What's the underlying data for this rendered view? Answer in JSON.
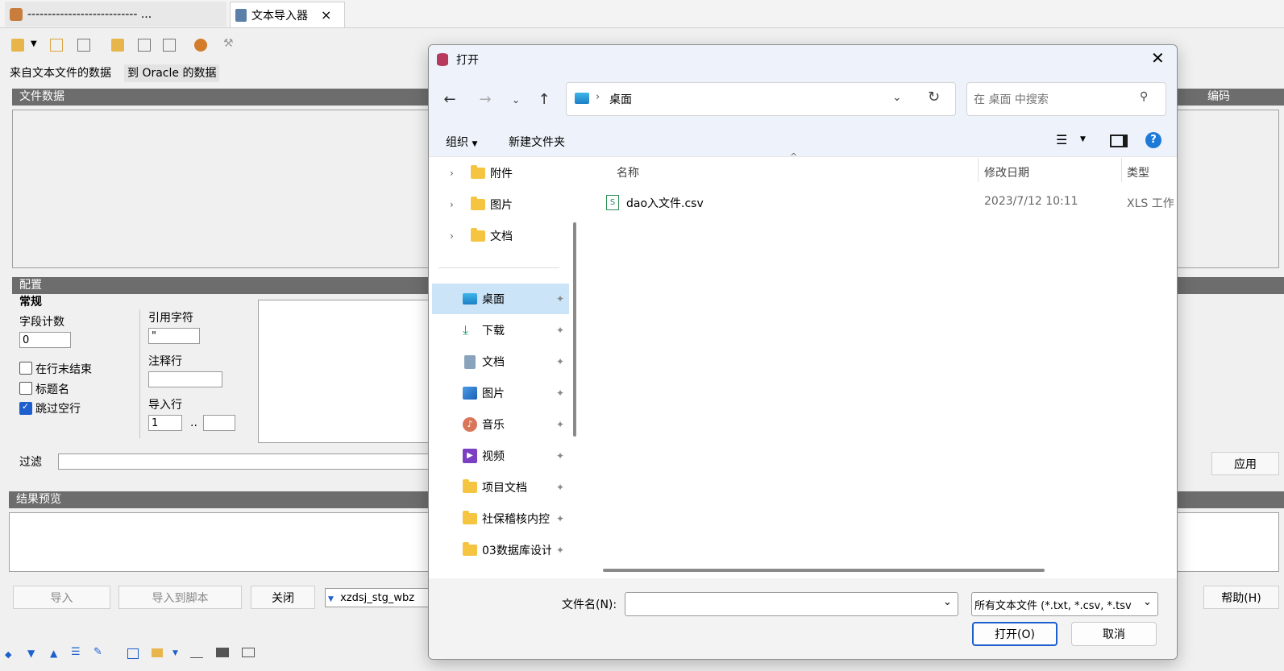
{
  "app": {
    "tabs": [
      {
        "label": "--------------------------- ..."
      },
      {
        "label": "文本导入器",
        "close": "×"
      }
    ],
    "subtabs": [
      "来自文本文件的数据",
      "到 Oracle 的数据"
    ],
    "sections": {
      "file_data": "文件数据",
      "config": "配置",
      "general": "常规",
      "result_preview": "结果预览",
      "encoding": "编码"
    },
    "config": {
      "field_count_label": "字段计数",
      "field_count_value": "0",
      "end_of_line": "在行末结束",
      "header": "标题名",
      "skip_empty": "跳过空行",
      "quote_char_label": "引用字符",
      "quote_char_value": "\"",
      "comment_label": "注释行",
      "import_rows_label": "导入行",
      "import_rows_from": "1",
      "import_rows_sep": ".."
    },
    "filter_label": "过滤",
    "apply_btn": "应用",
    "buttons": {
      "import": "导入",
      "import_script": "导入到脚本",
      "close": "关闭",
      "table": "xzdsj_stg_wbz",
      "help": "帮助(H)"
    }
  },
  "dialog": {
    "title": "打开",
    "address": "桌面",
    "search_placeholder": "在 桌面 中搜索",
    "organize": "组织",
    "new_folder": "新建文件夹",
    "tree_top": [
      {
        "label": "附件"
      },
      {
        "label": "图片"
      },
      {
        "label": "文档"
      }
    ],
    "quick_access": [
      {
        "label": "桌面",
        "icon": "desktop-icon",
        "selected": true
      },
      {
        "label": "下载",
        "icon": "download-icon"
      },
      {
        "label": "文档",
        "icon": "document-icon"
      },
      {
        "label": "图片",
        "icon": "picture-icon"
      },
      {
        "label": "音乐",
        "icon": "music-icon"
      },
      {
        "label": "视频",
        "icon": "video-icon"
      },
      {
        "label": "项目文档",
        "icon": "folder-synced-icon"
      },
      {
        "label": "社保稽核内控",
        "icon": "folder-synced-icon"
      },
      {
        "label": "03数据库设计",
        "icon": "folder-error-icon"
      }
    ],
    "columns": {
      "name": "名称",
      "modified": "修改日期",
      "type": "类型"
    },
    "files": [
      {
        "name": "dao入文件.csv",
        "modified": "2023/7/12 10:11",
        "type": "XLS 工作"
      }
    ],
    "filename_label": "文件名(N):",
    "filename_value": "",
    "filter": "所有文本文件 (*.txt, *.csv, *.tsv",
    "open_btn": "打开(O)",
    "cancel_btn": "取消"
  },
  "colors": {
    "accent": "#1e5fce",
    "selected_bg": "#cce4f7",
    "header_gray": "#6d6d6d"
  }
}
